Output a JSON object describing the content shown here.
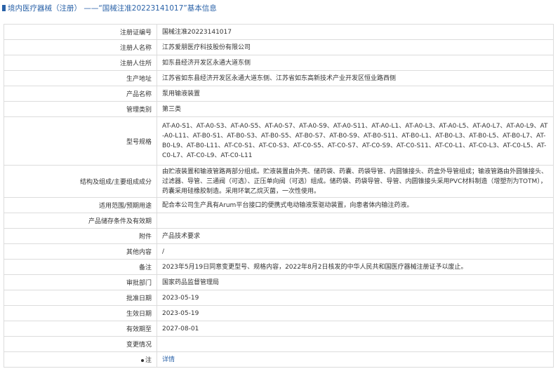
{
  "header": {
    "title": "境内医疗器械（注册） ——“国械注准20223141017”基本信息"
  },
  "rows": [
    {
      "label": "注册证编号",
      "value": "国械注准20223141017"
    },
    {
      "label": "注册人名称",
      "value": "江苏爱朋医疗科技股份有限公司"
    },
    {
      "label": "注册人住所",
      "value": "如东县经济开发区永通大道东侧"
    },
    {
      "label": "生产地址",
      "value": "江苏省如东县经济开发区永通大道东侧、江苏省如东高新技术产业开发区恒业路西侧"
    },
    {
      "label": "产品名称",
      "value": "泵用输液装置"
    },
    {
      "label": "管理类别",
      "value": "第三类"
    },
    {
      "label": "型号规格",
      "value": "AT-A0-S1、AT-A0-S3、AT-A0-S5、AT-A0-S7、AT-A0-S9、AT-A0-S11、AT-A0-L1、AT-A0-L3、AT-A0-L5、AT-A0-L7、AT-A0-L9、AT-A0-L11、AT-B0-S1、AT-B0-S3、AT-B0-S5、AT-B0-S7、AT-B0-S9、AT-B0-S11、AT-B0-L1、AT-B0-L3、AT-B0-L5、AT-B0-L7、AT-B0-L9、AT-B0-L11、AT-C0-S1、AT-C0-S3、AT-C0-S5、AT-C0-S7、AT-C0-S9、AT-C0-S11、AT-C0-L1、AT-C0-L3、AT-C0-L5、AT-C0-L7、AT-C0-L9、AT-C0-L11"
    },
    {
      "label": "结构及组成/主要组成成分",
      "value": "由贮液装置和输液管路两部分组成。贮液装置由外壳、储药袋、药囊、药袋导管、内圆锥接头、药盒外导管组成；输液管路由外圆锥接头、过滤器、导管、三通阀（可选）、正压单向阀（可选）组成。储药袋、药袋导管、导管、内圆锥接头采用PVC材料制造（增塑剂为TOTM），药囊采用硅橡胶制造。采用环氧乙烷灭菌，一次性使用。"
    },
    {
      "label": "适用范围/预期用途",
      "value": "配合本公司生产具有Arum平台接口的便携式电动输液泵驱动装置，向患者体内输注药液。"
    },
    {
      "label": "产品储存条件及有效期",
      "value": ""
    },
    {
      "label": "附件",
      "value": "产品技术要求"
    },
    {
      "label": "其他内容",
      "value": "/"
    },
    {
      "label": "备注",
      "value": "2023年5月19日同意变更型号、规格内容，2022年8月2日核发的中华人民共和国医疗器械注册证予以废止。"
    },
    {
      "label": "审批部门",
      "value": "国家药品监督管理局"
    },
    {
      "label": "批准日期",
      "value": "2023-05-19"
    },
    {
      "label": "生效日期",
      "value": "2023-05-19"
    },
    {
      "label": "有效期至",
      "value": "2027-08-01"
    },
    {
      "label": "变更情况",
      "value": ""
    }
  ],
  "note": {
    "label": "注",
    "link": "详情"
  }
}
